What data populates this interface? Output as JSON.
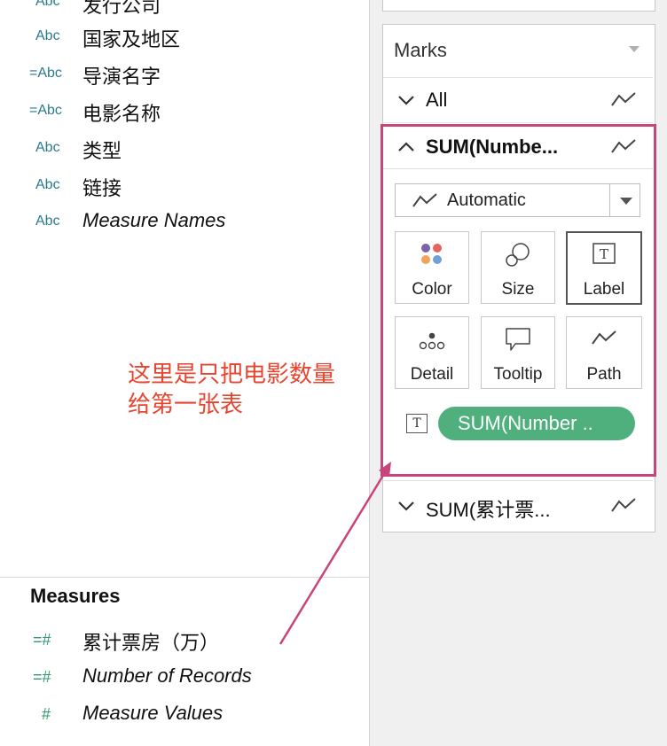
{
  "dimensions": [
    {
      "type": "Abc",
      "name": "发行公司",
      "italic": false
    },
    {
      "type": "Abc",
      "name": "国家及地区",
      "italic": false
    },
    {
      "type": "=Abc",
      "name": "导演名字",
      "italic": false
    },
    {
      "type": "=Abc",
      "name": "电影名称",
      "italic": false
    },
    {
      "type": "Abc",
      "name": "类型",
      "italic": false
    },
    {
      "type": "Abc",
      "name": "链接",
      "italic": false
    },
    {
      "type": "Abc",
      "name": "Measure Names",
      "italic": true
    }
  ],
  "measures": {
    "title": "Measures",
    "items": [
      {
        "type": "=#",
        "name": "累计票房（万）",
        "italic": false
      },
      {
        "type": "=#",
        "name": "Number of Records",
        "italic": true
      },
      {
        "type": "#",
        "name": "Measure Values",
        "italic": true
      }
    ]
  },
  "marks": {
    "title": "Marks",
    "all_label": "All",
    "active_label": "SUM(Numbe...",
    "mark_type": "Automatic",
    "tiles": [
      {
        "label": "Color",
        "icon": "color-icon",
        "active": false
      },
      {
        "label": "Size",
        "icon": "size-icon",
        "active": false
      },
      {
        "label": "Label",
        "icon": "label-icon",
        "active": true
      },
      {
        "label": "Detail",
        "icon": "detail-icon",
        "active": false
      },
      {
        "label": "Tooltip",
        "icon": "tooltip-icon",
        "active": false
      },
      {
        "label": "Path",
        "icon": "path-icon",
        "active": false
      }
    ],
    "pill_label": "SUM(Number ..",
    "second_label": "SUM(累计票..."
  },
  "annotation": {
    "line1": "这里是只把电影数量",
    "line2": "给第一张表"
  },
  "colors": {
    "dimension": "#2a7a8f",
    "measure": "#2f9a6c",
    "pill": "#4fb07e",
    "highlight": "#c8457a",
    "annotation": "#e6452f"
  }
}
